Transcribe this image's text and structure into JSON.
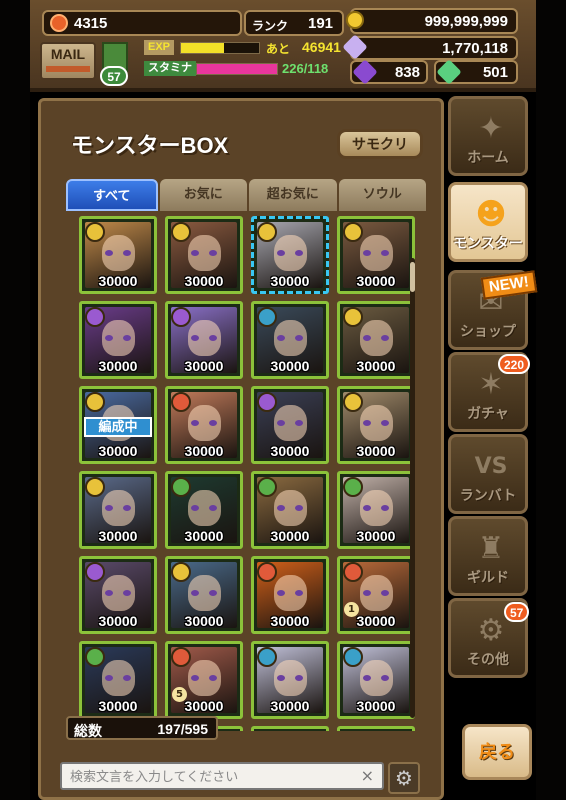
{
  "header": {
    "coins": "4315",
    "rank_label": "ランク",
    "rank": "191",
    "gold": "999,999,999",
    "crystals": "1,770,118",
    "mail_label": "MAIL",
    "mail_count": "57",
    "exp_label": "EXP",
    "exp_remaining_label": "あと",
    "exp_remaining": "46941",
    "exp_fill": 0.55,
    "stamina_label": "スタミナ",
    "stamina": "226/118",
    "stamina_fill": 1.0,
    "purple_gems": "838",
    "green_gems": "501"
  },
  "panel": {
    "title": "モンスターBOX",
    "summon_button": "サモクリ",
    "tabs": [
      "すべて",
      "お気に",
      "超お気に",
      "ソウル"
    ],
    "active_tab": 0,
    "total_label": "総数",
    "total_value": "197/595",
    "search_placeholder": "検索文言を入力してください",
    "search_value": ""
  },
  "cards": [
    {
      "value": "30000",
      "color": "#c08a4a",
      "elem": "#e8c23a"
    },
    {
      "value": "30000",
      "color": "#8a5a40",
      "elem": "#e8c23a"
    },
    {
      "value": "30000",
      "color": "#a7a7b0",
      "elem": "#e8c23a",
      "selected": true
    },
    {
      "value": "30000",
      "color": "#7a5a40",
      "elem": "#e8c23a"
    },
    {
      "value": "30000",
      "color": "#6a3c8a",
      "elem": "#9a5ad0"
    },
    {
      "value": "30000",
      "color": "#8a70c8",
      "elem": "#9a5ad0"
    },
    {
      "value": "30000",
      "color": "#3a4a5a",
      "elem": "#3aa0c8"
    },
    {
      "value": "30000",
      "color": "#6a5a40",
      "elem": "#e8c23a"
    },
    {
      "value": "30000",
      "color": "#4a6aa0",
      "elem": "#e8c23a",
      "badge": "編成中"
    },
    {
      "value": "30000",
      "color": "#c07a5a",
      "elem": "#e05a3a"
    },
    {
      "value": "30000",
      "color": "#3a3f55",
      "elem": "#9a5ad0"
    },
    {
      "value": "30000",
      "color": "#a08a6a",
      "elem": "#e8c23a"
    },
    {
      "value": "30000",
      "color": "#5a6a8a",
      "elem": "#e8c23a"
    },
    {
      "value": "30000",
      "color": "#1e3a30",
      "elem": "#5ab04a"
    },
    {
      "value": "30000",
      "color": "#8a6a40",
      "elem": "#5ab04a"
    },
    {
      "value": "30000",
      "color": "#c0b0a8",
      "elem": "#5ab04a"
    },
    {
      "value": "30000",
      "color": "#5a4a6a",
      "elem": "#9a5ad0"
    },
    {
      "value": "30000",
      "color": "#4a6a8a",
      "elem": "#e8c23a"
    },
    {
      "value": "30000",
      "color": "#d0601a",
      "elem": "#e05a3a"
    },
    {
      "value": "30000",
      "color": "#b86a3a",
      "elem": "#e05a3a",
      "sub": "1"
    },
    {
      "value": "30000",
      "color": "#2a3a5a",
      "elem": "#5ab04a"
    },
    {
      "value": "30000",
      "color": "#a05a4a",
      "elem": "#e05a3a",
      "sub": "5"
    },
    {
      "value": "30000",
      "color": "#c0c0d8",
      "elem": "#3aa0c8"
    },
    {
      "value": "30000",
      "color": "#c0c0d8",
      "elem": "#3aa0c8"
    },
    {
      "value": "",
      "color": "#6a5a40",
      "elem": "#e8c23a"
    },
    {
      "value": "",
      "color": "#5a4a3a",
      "elem": "#e05a3a"
    },
    {
      "value": "",
      "color": "#3a4a5a",
      "elem": "#5ab04a"
    },
    {
      "value": "",
      "color": "#5a4a3a",
      "elem": "#e8c23a"
    }
  ],
  "nav": [
    {
      "label": "ホーム",
      "icon": "✦",
      "badge": ""
    },
    {
      "label": "モンスター",
      "icon": "☻",
      "badge": "",
      "active": true
    },
    {
      "label": "ショップ",
      "icon": "✉",
      "badge": ""
    },
    {
      "label": "ガチャ",
      "icon": "✶",
      "badge": "220"
    },
    {
      "label": "ランバト",
      "icon": "VS",
      "badge": ""
    },
    {
      "label": "ギルド",
      "icon": "♜",
      "badge": ""
    },
    {
      "label": "その他",
      "icon": "⚙",
      "badge": "57"
    }
  ],
  "new_tag": "NEW!",
  "back_button": "戻る",
  "colors": {
    "exp_bar": "#f2e028",
    "stamina_bar": "#e8369c",
    "active_tab": "#2a62d0",
    "card_border": "#8cc23a"
  }
}
